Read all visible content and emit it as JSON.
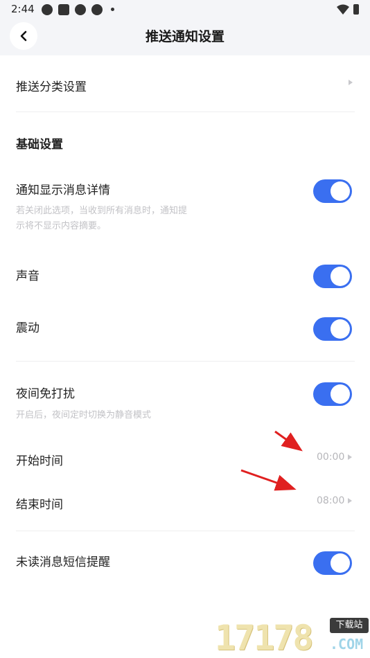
{
  "status_bar": {
    "time": "2:44"
  },
  "header": {
    "title": "推送通知设置"
  },
  "settings": {
    "push_category": {
      "label": "推送分类设置"
    },
    "basic_section_title": "基础设置",
    "show_details": {
      "label": "通知显示消息详情",
      "desc_line1": "若关闭此选项，当收到所有消息时，通知提",
      "desc_line2": "示将不显示内容摘要。",
      "enabled": true
    },
    "sound": {
      "label": "声音",
      "enabled": true
    },
    "vibrate": {
      "label": "震动",
      "enabled": true
    },
    "dnd": {
      "label": "夜间免打扰",
      "desc": "开启后，夜间定时切换为静音模式",
      "enabled": true
    },
    "start_time": {
      "label": "开始时间",
      "value": "00:00"
    },
    "end_time": {
      "label": "结束时间",
      "value": "08:00"
    },
    "sms_reminder": {
      "label": "未读消息短信提醒",
      "enabled": true
    }
  },
  "watermark": {
    "text": "17178",
    "badge": "下载站",
    "suffix": ".COM"
  },
  "colors": {
    "accent": "#3a6ff0",
    "annotation_arrow": "#e02020"
  }
}
